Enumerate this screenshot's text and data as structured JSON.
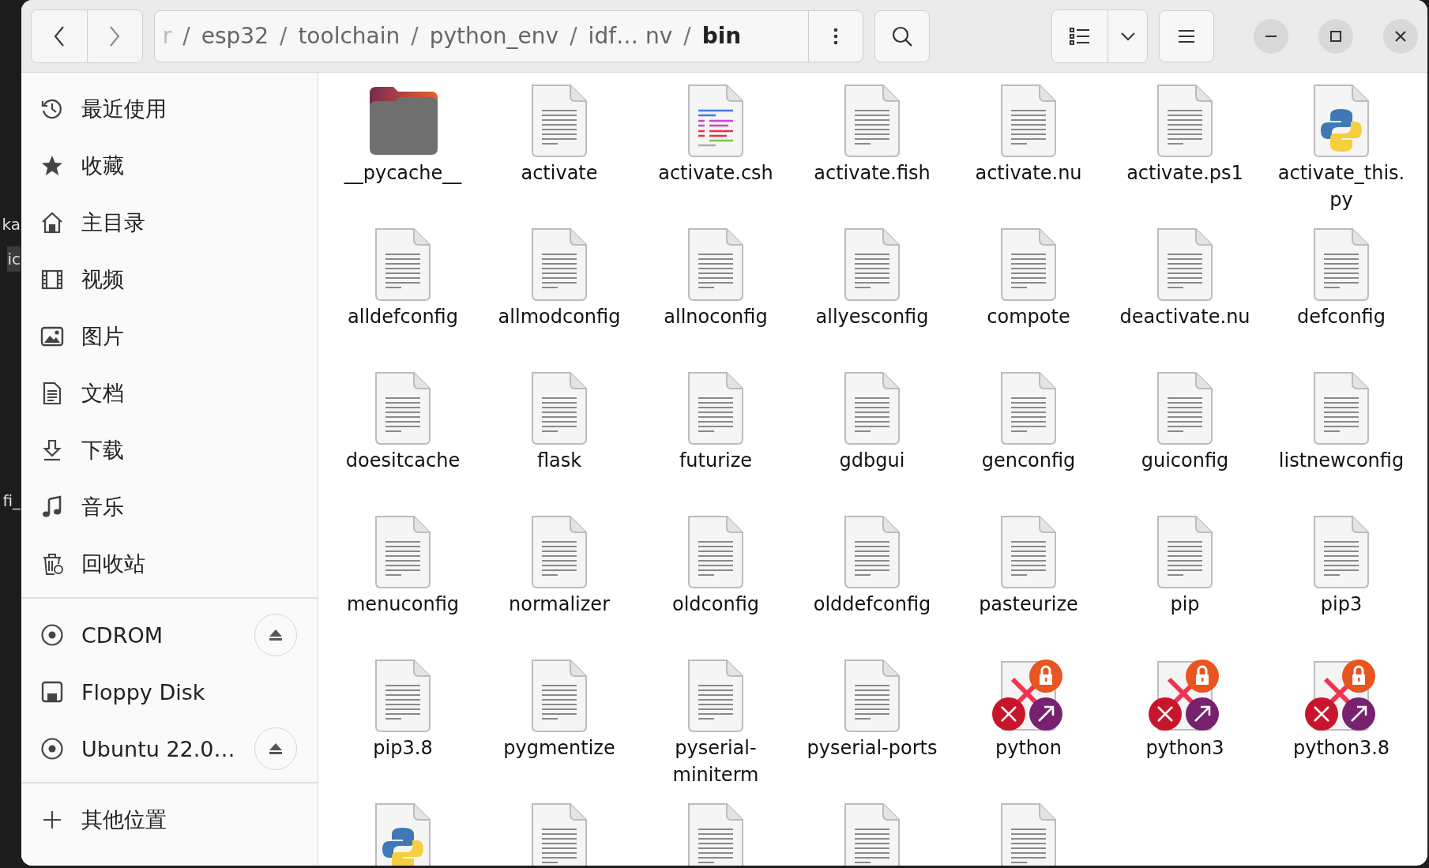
{
  "background_texts": [
    "ka",
    "ic",
    "fi_"
  ],
  "path_bar": {
    "separator": "/",
    "segments": [
      {
        "label": "r",
        "selected": false
      },
      {
        "label": "esp32",
        "selected": false
      },
      {
        "label": "toolchain",
        "selected": false
      },
      {
        "label": "python_env",
        "selected": false
      },
      {
        "label": "idf… nv",
        "selected": false
      },
      {
        "label": "bin",
        "selected": true
      }
    ]
  },
  "sidebar": {
    "places": [
      {
        "label": "最近使用"
      },
      {
        "label": "收藏"
      },
      {
        "label": "主目录"
      },
      {
        "label": "视频"
      },
      {
        "label": "图片"
      },
      {
        "label": "文档"
      },
      {
        "label": "下载"
      },
      {
        "label": "音乐"
      },
      {
        "label": "回收站"
      }
    ],
    "devices": [
      {
        "label": "CDROM",
        "kind": "disc",
        "ejectable": true
      },
      {
        "label": "Floppy Disk",
        "kind": "floppy",
        "ejectable": false
      },
      {
        "label": "Ubuntu 22.0…",
        "kind": "disc",
        "ejectable": true
      }
    ],
    "other": {
      "label": "其他位置"
    }
  },
  "files": [
    {
      "name": "__pycache__",
      "kind": "folder"
    },
    {
      "name": "activate",
      "kind": "text"
    },
    {
      "name": "activate.csh",
      "kind": "script"
    },
    {
      "name": "activate.fish",
      "kind": "text"
    },
    {
      "name": "activate.nu",
      "kind": "text"
    },
    {
      "name": "activate.ps1",
      "kind": "text"
    },
    {
      "name": "activate_this.py",
      "kind": "python"
    },
    {
      "name": "alldefconfig",
      "kind": "text"
    },
    {
      "name": "allmodconfig",
      "kind": "text"
    },
    {
      "name": "allnoconfig",
      "kind": "text"
    },
    {
      "name": "allyesconfig",
      "kind": "text"
    },
    {
      "name": "compote",
      "kind": "text"
    },
    {
      "name": "deactivate.nu",
      "kind": "text"
    },
    {
      "name": "defconfig",
      "kind": "text"
    },
    {
      "name": "doesitcache",
      "kind": "text"
    },
    {
      "name": "flask",
      "kind": "text"
    },
    {
      "name": "futurize",
      "kind": "text"
    },
    {
      "name": "gdbgui",
      "kind": "text"
    },
    {
      "name": "genconfig",
      "kind": "text"
    },
    {
      "name": "guiconfig",
      "kind": "text"
    },
    {
      "name": "listnewconfig",
      "kind": "text"
    },
    {
      "name": "menuconfig",
      "kind": "text"
    },
    {
      "name": "normalizer",
      "kind": "text"
    },
    {
      "name": "oldconfig",
      "kind": "text"
    },
    {
      "name": "olddefconfig",
      "kind": "text"
    },
    {
      "name": "pasteurize",
      "kind": "text"
    },
    {
      "name": "pip",
      "kind": "text"
    },
    {
      "name": "pip3",
      "kind": "text"
    },
    {
      "name": "pip3.8",
      "kind": "text"
    },
    {
      "name": "pygmentize",
      "kind": "text"
    },
    {
      "name": "pyserial-miniterm",
      "kind": "text"
    },
    {
      "name": "pyserial-ports",
      "kind": "text"
    },
    {
      "name": "python",
      "kind": "broken-link"
    },
    {
      "name": "python3",
      "kind": "broken-link"
    },
    {
      "name": "python3.8",
      "kind": "broken-link"
    },
    {
      "kind": "python"
    },
    {
      "kind": "text"
    },
    {
      "kind": "text"
    },
    {
      "kind": "text"
    },
    {
      "kind": "text"
    }
  ]
}
